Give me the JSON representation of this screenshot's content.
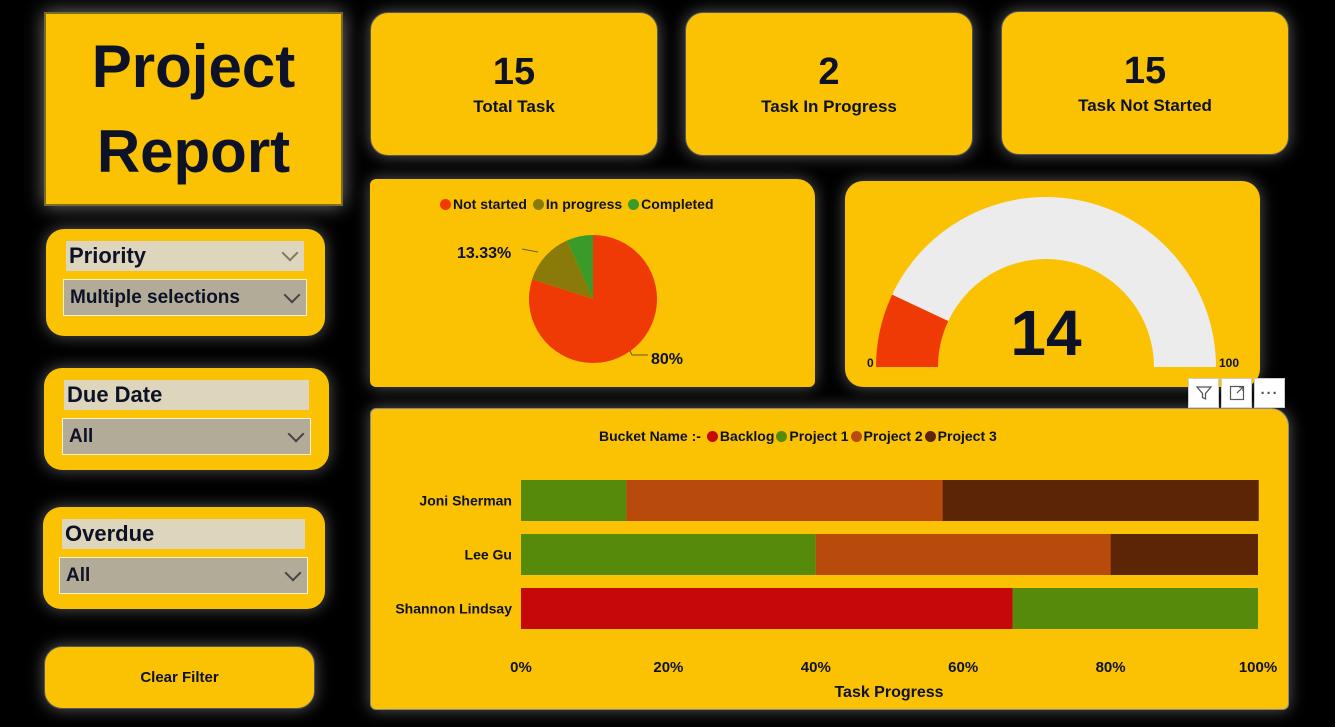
{
  "title": {
    "line1": "Project",
    "line2": "Report"
  },
  "kpis": [
    {
      "value": "15",
      "label": "Total Task"
    },
    {
      "value": "2",
      "label": "Task In Progress"
    },
    {
      "value": "15",
      "label": "Task Not Started"
    }
  ],
  "slicers": {
    "priority": {
      "label": "Priority",
      "value": "Multiple selections"
    },
    "due_date": {
      "label": "Due Date",
      "value": "All"
    },
    "overdue": {
      "label": "Overdue",
      "value": "All"
    }
  },
  "clear_filter_label": "Clear Filter",
  "pie": {
    "legend": [
      {
        "name": "Not started",
        "color": "#f03a06"
      },
      {
        "name": "In progress",
        "color": "#8a7a0a"
      },
      {
        "name": "Completed",
        "color": "#3a9a2a"
      }
    ],
    "label_small": "13.33%",
    "label_large": "80%",
    "values": [
      80,
      13.33,
      6.67
    ]
  },
  "gauge": {
    "value_text": "14",
    "min_label": "0",
    "max_label": "100",
    "value": 14,
    "min": 0,
    "max": 100,
    "fill_color": "#f03a06",
    "track_color": "#ececec"
  },
  "chart_data": {
    "type": "bar",
    "orientation": "horizontal",
    "stacked": "100%",
    "title": "",
    "xlabel": "Task Progress",
    "ylabel": "",
    "legend_title": "Bucket Name :-",
    "categories": [
      "Joni Sherman",
      "Lee Gu",
      "Shannon Lindsay"
    ],
    "series": [
      {
        "name": "Backlog",
        "color": "#c50808",
        "values": [
          0,
          0,
          66.7
        ]
      },
      {
        "name": "Project 1",
        "color": "#568a0a",
        "values": [
          14.3,
          40,
          33.3
        ]
      },
      {
        "name": "Project 2",
        "color": "#b84a0c",
        "values": [
          42.9,
          40,
          0
        ]
      },
      {
        "name": "Project 3",
        "color": "#5c2606",
        "values": [
          42.9,
          20,
          0
        ]
      }
    ],
    "xticks": [
      "0%",
      "20%",
      "40%",
      "60%",
      "80%",
      "100%"
    ],
    "xlim": [
      0,
      100
    ]
  },
  "icons": {
    "filter": "filter-icon",
    "focus": "focus-mode-icon",
    "more": "more-options-icon"
  }
}
